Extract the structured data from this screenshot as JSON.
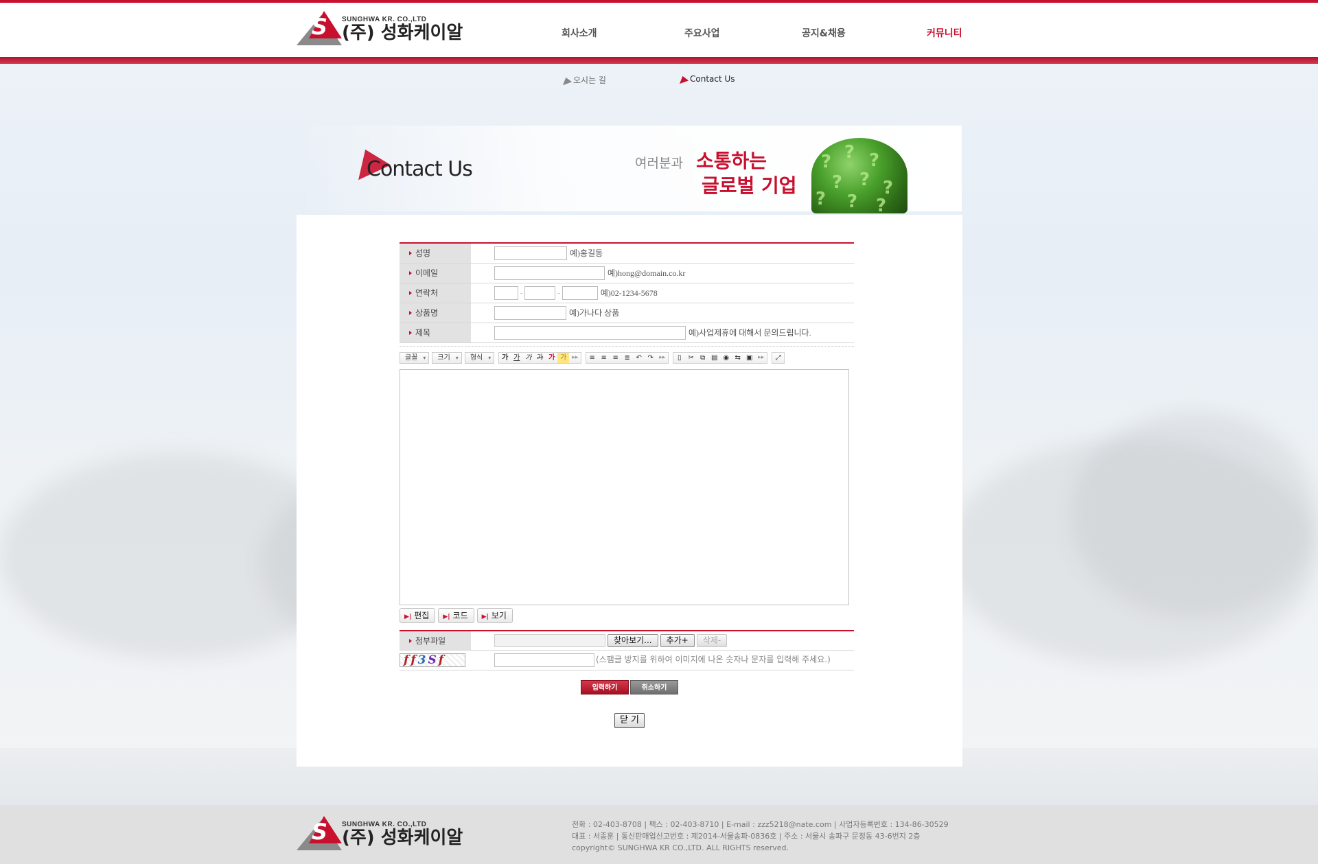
{
  "header": {
    "logo_en": "SUNGHWA KR. CO.,LTD",
    "logo_ko": "(주) 성화케이알",
    "nav": [
      {
        "label": "회사소개"
      },
      {
        "label": "주요사업"
      },
      {
        "label": "공지&채용"
      },
      {
        "label": "커뮤니티",
        "active": true
      }
    ],
    "subnav": [
      {
        "label": "오시는 길"
      },
      {
        "label": "Contact Us",
        "active": true
      }
    ],
    "brand_color": "#c8102e"
  },
  "banner": {
    "title": "Contact Us",
    "slogan_prefix": "여러분과",
    "slogan_line1": "소통하는",
    "slogan_line2": "글로벌 기업"
  },
  "form": {
    "fields": [
      {
        "label": "성명",
        "value": "",
        "hint": "예)홍길동"
      },
      {
        "label": "이메일",
        "value": "",
        "hint": "예)hong@domain.co.kr"
      },
      {
        "label": "연락처",
        "value": [
          "",
          "",
          ""
        ],
        "separator": "-",
        "hint": "예)02-1234-5678"
      },
      {
        "label": "상품명",
        "value": "",
        "hint": "예)가나다 상품"
      },
      {
        "label": "제목",
        "value": "",
        "hint": "예)사업제휴에 대해서 문의드립니다."
      }
    ],
    "toolbar": {
      "selects": [
        "글꼴",
        "크기",
        "형식"
      ],
      "text_style": [
        "가",
        "가",
        "가",
        "가",
        "가",
        "가"
      ],
      "more": "▸▸"
    },
    "editor_content": "",
    "modes": [
      "편집",
      "코드",
      "보기"
    ],
    "attach": {
      "label": "첨부파일",
      "browse": "찾아보기...",
      "add": "추가+",
      "remove": "삭제-"
    },
    "captcha": {
      "chars": [
        "f",
        "f",
        "3",
        "S",
        "f"
      ],
      "value": "",
      "notice": "(스팸글 방지를 위하여 이미지에 나온 숫자나 문자를 입력해 주세요.)"
    },
    "submit": "입력하기",
    "cancel": "취소하기",
    "close": "닫 기"
  },
  "footer": {
    "logo_en": "SUNGHWA KR. CO.,LTD",
    "logo_ko": "(주) 성화케이알",
    "line1": "전화 : 02-403-8708  |  팩스 : 02-403-8710   |   E-mail : zzz5218@nate.com  | 사업자등록번호 : 134-86-30529",
    "line2": "대표 : 서종훈 |  통신판매업신고번호 : 제2014-서울송파-0836호  |   주소 : 서울시 송파구 문정동 43-6번지 2층",
    "line3": "copyright© SUNGHWA KR CO.,LTD. ALL RIGHTS reserved."
  }
}
